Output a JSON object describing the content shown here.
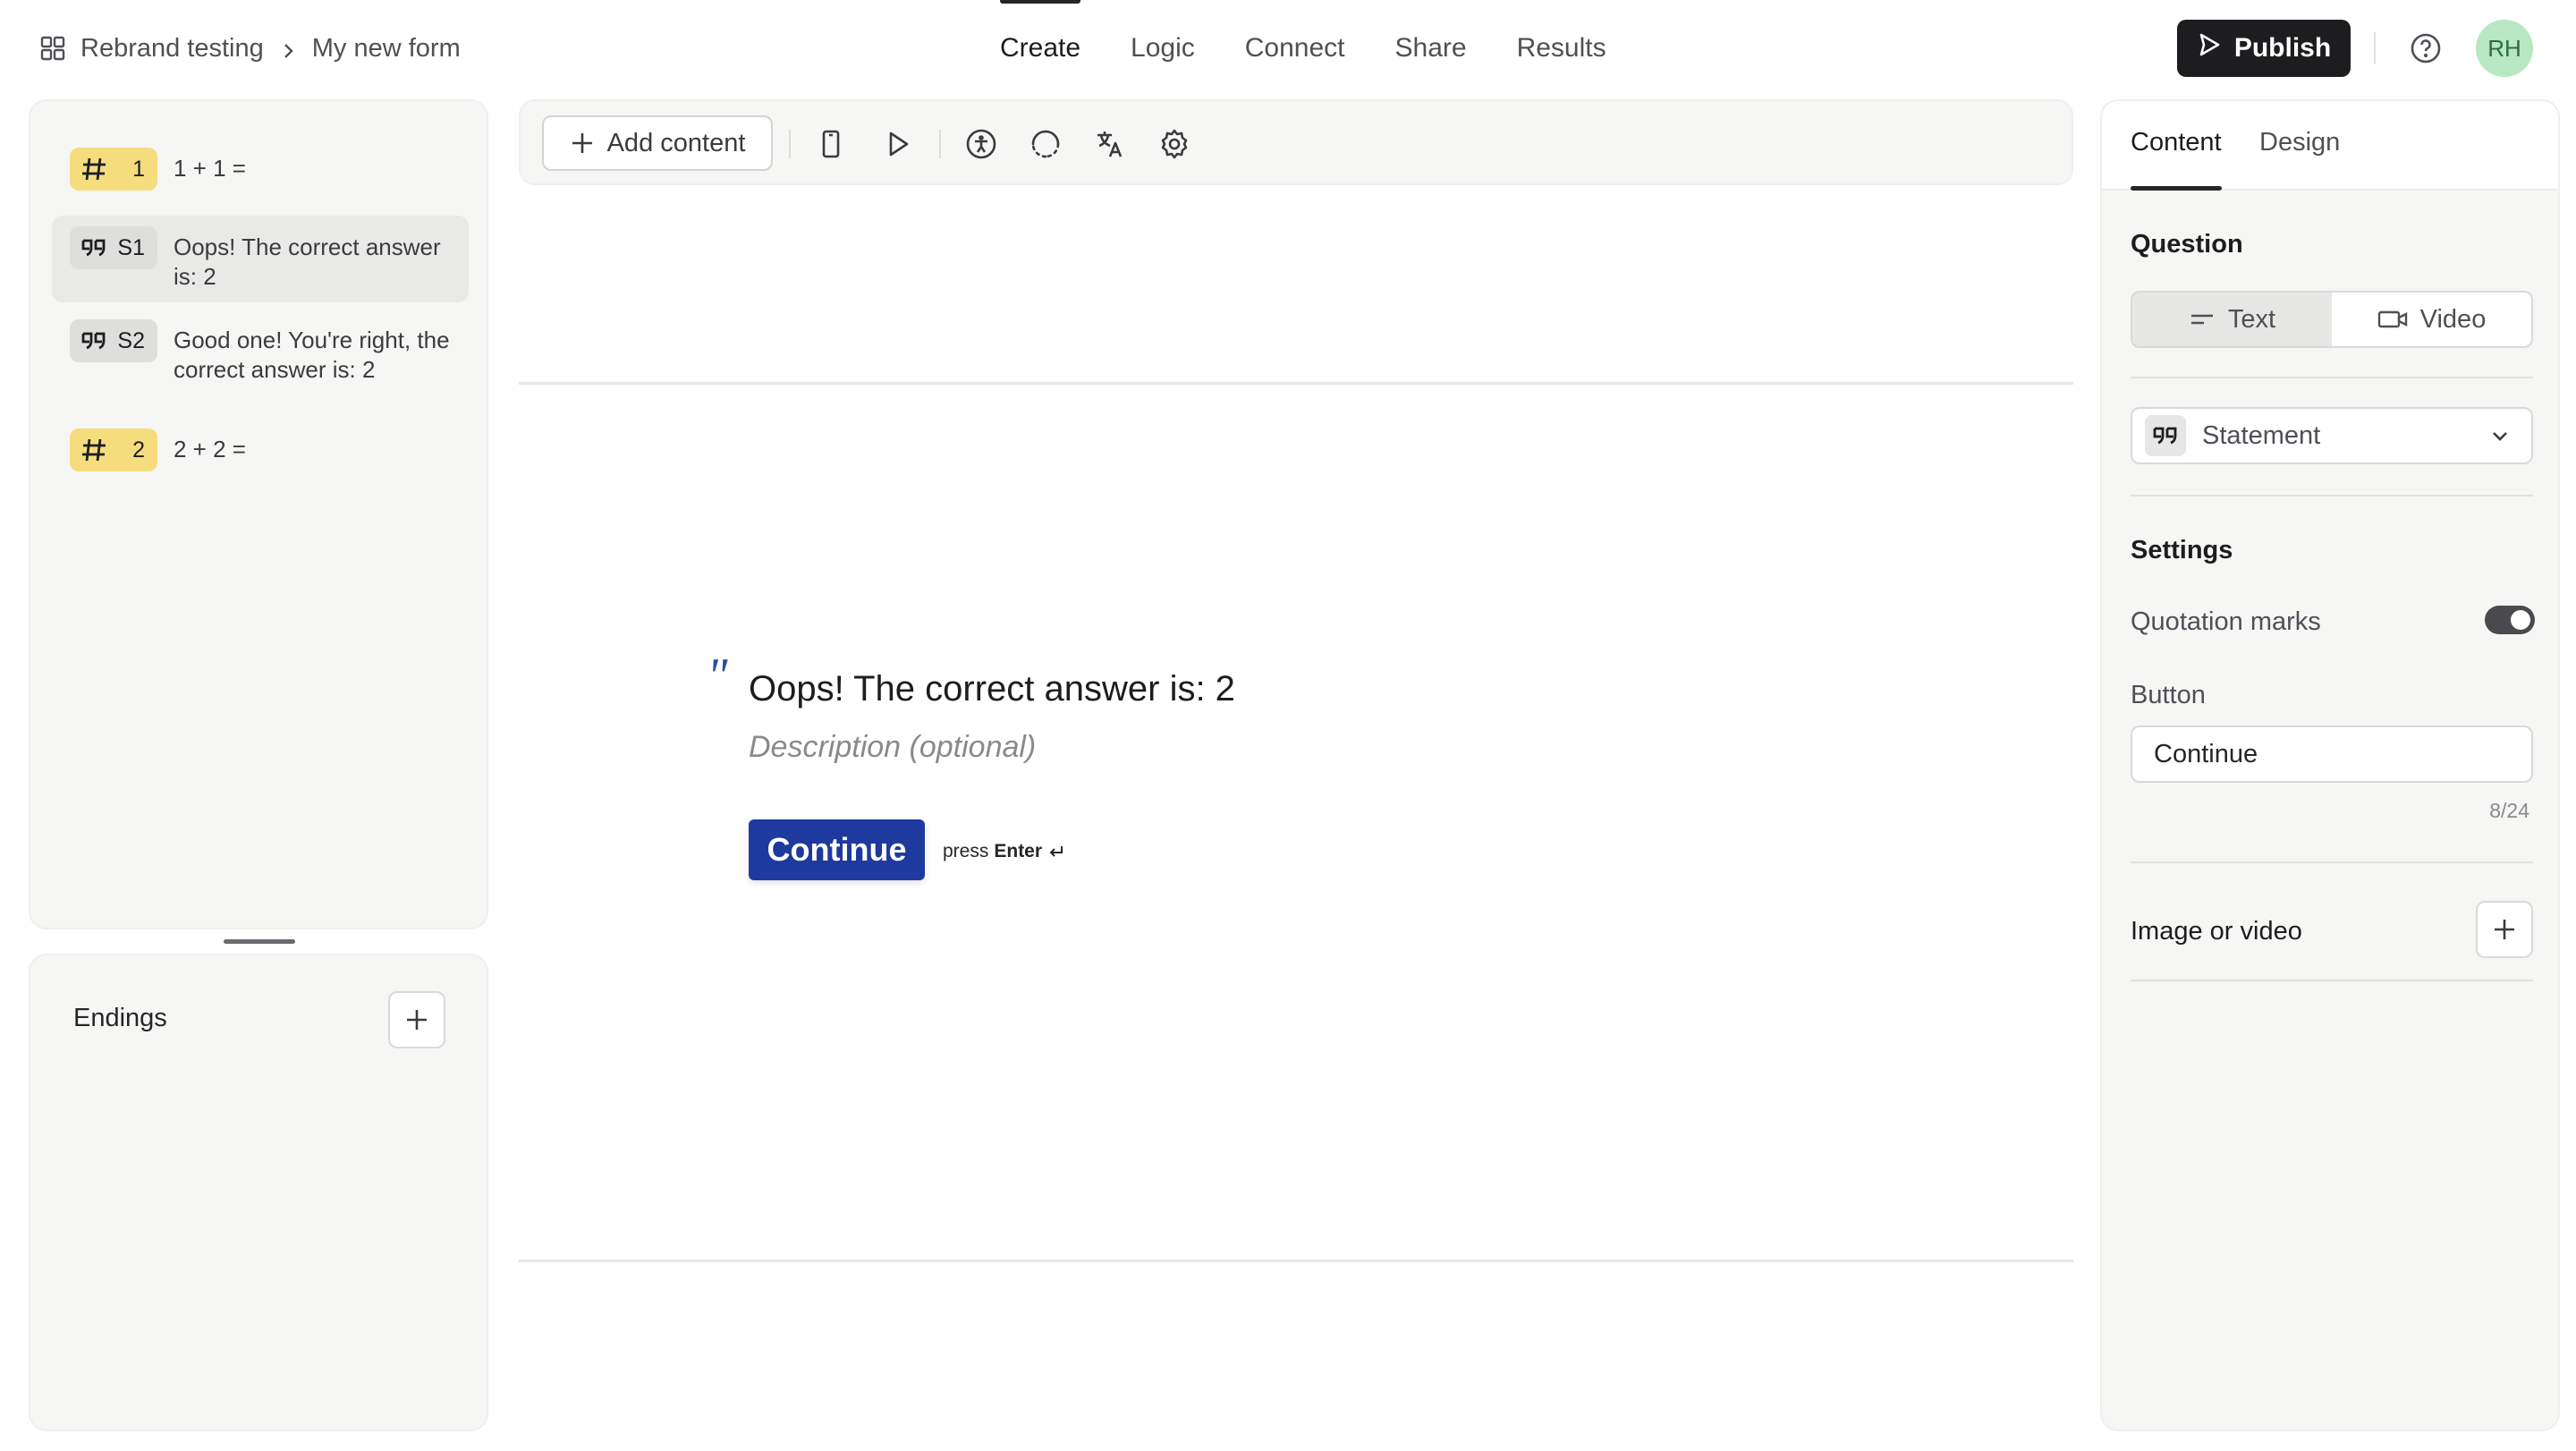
{
  "breadcrumb": {
    "workspace": "Rebrand testing",
    "form": "My new form"
  },
  "nav": {
    "tabs": [
      "Create",
      "Logic",
      "Connect",
      "Share",
      "Results"
    ],
    "active": "Create"
  },
  "header": {
    "publish_label": "Publish",
    "avatar_initials": "RH"
  },
  "questions": [
    {
      "type": "number",
      "badge": "1",
      "text": "1 + 1 ="
    },
    {
      "type": "statement",
      "badge": "S1",
      "text": "Oops! The correct answer is: 2",
      "selected": true
    },
    {
      "type": "statement",
      "badge": "S2",
      "text": "Good one! You're right, the correct answer is: 2"
    },
    {
      "type": "number",
      "badge": "2",
      "text": "2 + 2 ="
    }
  ],
  "endings": {
    "label": "Endings"
  },
  "toolbar": {
    "add_content_label": "Add content"
  },
  "canvas": {
    "title": "Oops! The correct answer is: 2",
    "description_placeholder": "Description (optional)",
    "button_label": "Continue",
    "press_label": "press",
    "enter_label": "Enter"
  },
  "right_panel": {
    "tabs": [
      "Content",
      "Design"
    ],
    "active_tab": "Content",
    "question_label": "Question",
    "segment": [
      "Text",
      "Video"
    ],
    "segment_active": "Text",
    "question_type": "Statement",
    "settings_label": "Settings",
    "quotation_marks_label": "Quotation marks",
    "quotation_marks_on": true,
    "button_label": "Button",
    "button_value": "Continue",
    "button_counter": "8/24",
    "media_label": "Image or video"
  },
  "colors": {
    "publish_bg": "#1d1d1f",
    "continue_bg": "#1e3a9e",
    "number_badge": "#f5dd7e",
    "avatar_bg": "#b7e7c3"
  }
}
